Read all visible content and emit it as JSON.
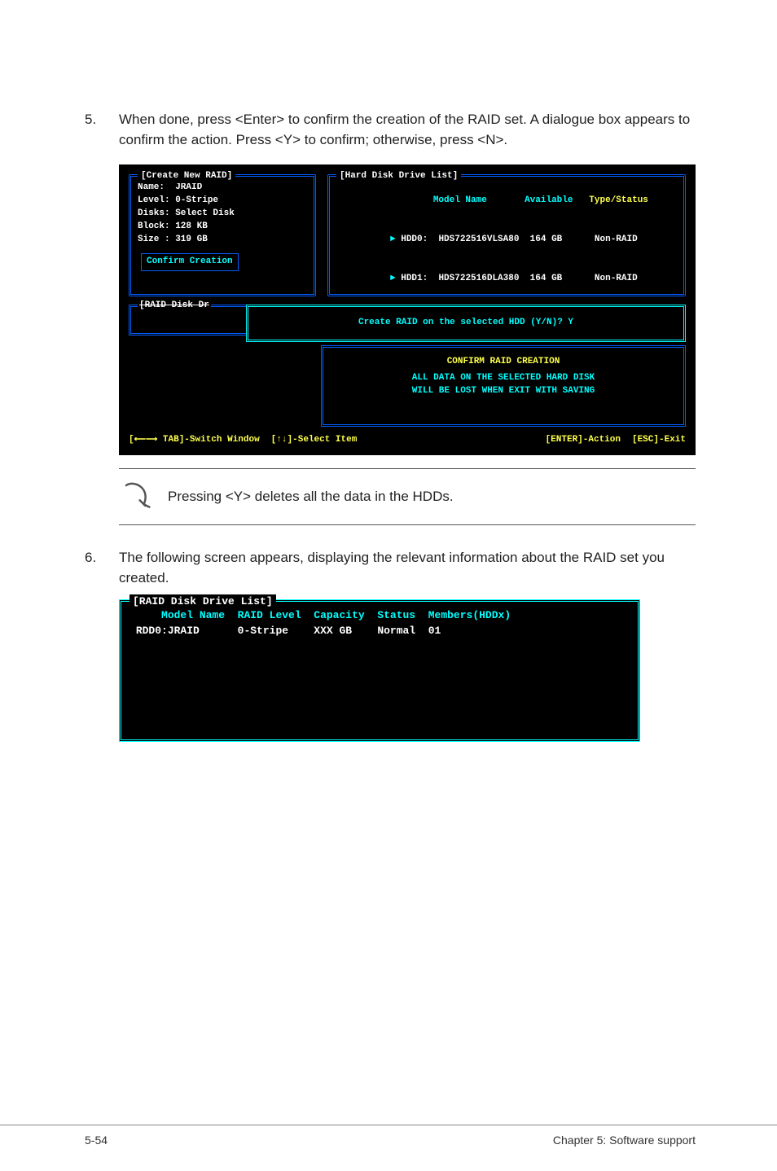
{
  "step5": {
    "num": "5.",
    "text": "When done, press <Enter> to confirm the creation of the RAID set. A dialogue box appears to confirm the action. Press <Y> to confirm; otherwise, press <N>."
  },
  "console1": {
    "create_panel": {
      "title": "[Create New RAID]",
      "lines": {
        "name": "Name:  JRAID",
        "level": "Level: 0-Stripe",
        "disks": "Disks: Select Disk",
        "block": "Block: 128 KB",
        "size": "Size : 319 GB"
      },
      "confirm_link": "Confirm Creation"
    },
    "hdd_panel": {
      "title": "[Hard Disk Drive List]",
      "header": {
        "model": "Model Name",
        "avail": "Available",
        "type": "Type/Status"
      },
      "rows": [
        {
          "id": "HDD0:",
          "model": "HDS722516VLSA80",
          "avail": "164 GB",
          "type": "Non-RAID"
        },
        {
          "id": "HDD1:",
          "model": "HDS722516DLA380",
          "avail": "164 GB",
          "type": "Non-RAID"
        }
      ]
    },
    "raid_disk_title": "[RAID Disk Dr",
    "create_prompt": "Create RAID on the selected HDD (Y/N)? Y",
    "confirm_box": {
      "title": "CONFIRM RAID CREATION",
      "line1": "ALL DATA ON THE SELECTED HARD DISK",
      "line2": "WILL BE LOST WHEN EXIT WITH SAVING"
    },
    "help": {
      "switch": "TAB]-Switch Window",
      "select": "[↑↓]-Select Item",
      "action": "[ENTER]-Action",
      "exit": "[ESC]-Exit"
    }
  },
  "note": {
    "text": "Pressing <Y> deletes all the data in the HDDs."
  },
  "step6": {
    "num": "6.",
    "text": "The following screen appears, displaying the relevant information about the RAID set you created."
  },
  "console2": {
    "title": "[RAID Disk Drive List]",
    "header": {
      "model": "Model Name",
      "level": "RAID Level",
      "cap": "Capacity",
      "status": "Status",
      "members": "Members(HDDx)"
    },
    "row": {
      "model": "RDD0:JRAID",
      "level": "0-Stripe",
      "cap": "XXX GB",
      "status": "Normal",
      "members": "01"
    }
  },
  "footer": {
    "left": "5-54",
    "right": "Chapter 5: Software support"
  }
}
